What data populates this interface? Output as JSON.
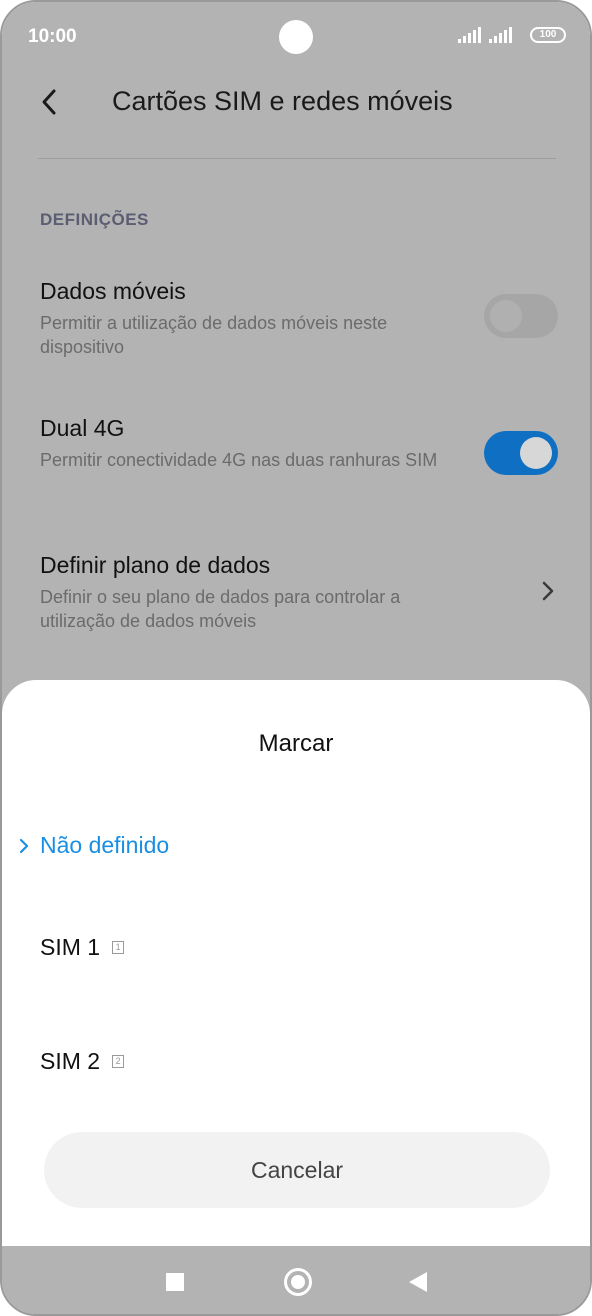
{
  "status_bar": {
    "time": "10:00",
    "battery": "100"
  },
  "header": {
    "title": "Cartões SIM e redes móveis"
  },
  "section": {
    "label": "DEFINIÇÕES"
  },
  "settings": [
    {
      "title": "Dados móveis",
      "description": "Permitir a utilização de dados móveis neste dispositivo",
      "toggle": "off"
    },
    {
      "title": "Dual 4G",
      "description": "Permitir conectividade 4G nas duas ranhuras SIM",
      "toggle": "on"
    },
    {
      "title": "Definir plano de dados",
      "description": "Definir o seu plano de dados para controlar a utilização de dados móveis"
    }
  ],
  "sheet": {
    "title": "Marcar",
    "options": [
      {
        "label": "Não definido",
        "selected": true
      },
      {
        "label": "SIM 1",
        "badge": "1"
      },
      {
        "label": "SIM 2",
        "badge": "2"
      }
    ],
    "cancel_label": "Cancelar"
  },
  "colors": {
    "accent": "#1a8fe3",
    "toggle_on": "#0f6fc2",
    "dim_overlay": "#b3b3b3"
  },
  "icons": [
    "back-arrow-icon",
    "chevron-right-icon",
    "check-chevron-icon",
    "sim-1-icon",
    "sim-2-icon",
    "recents-icon",
    "home-icon",
    "back-icon"
  ]
}
